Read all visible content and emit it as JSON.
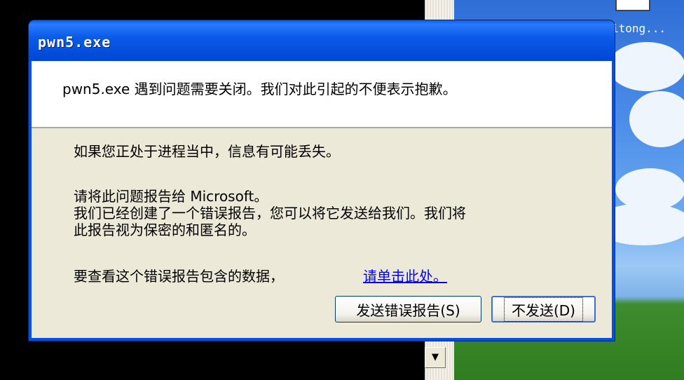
{
  "desktop": {
    "icon_label": "itong..."
  },
  "dialog": {
    "title": "pwn5.exe",
    "header_message": "pwn5.exe 遇到问题需要关闭。我们对此引起的不便表示抱歉。",
    "paragraph1": "如果您正处于进程当中，信息有可能丢失。",
    "paragraph2": "请将此问题报告给 Microsoft。\n我们已经创建了一个错误报告，您可以将它发送给我们。我们将\n此报告视为保密的和匿名的。",
    "paragraph3": "要查看这个错误报告包含的数据，",
    "link": "请单击此处。",
    "send_button": "发送错误报告(S)",
    "dont_send_button": "不发送(D)"
  },
  "console": {
    "scroll_down_glyph": "▼"
  }
}
